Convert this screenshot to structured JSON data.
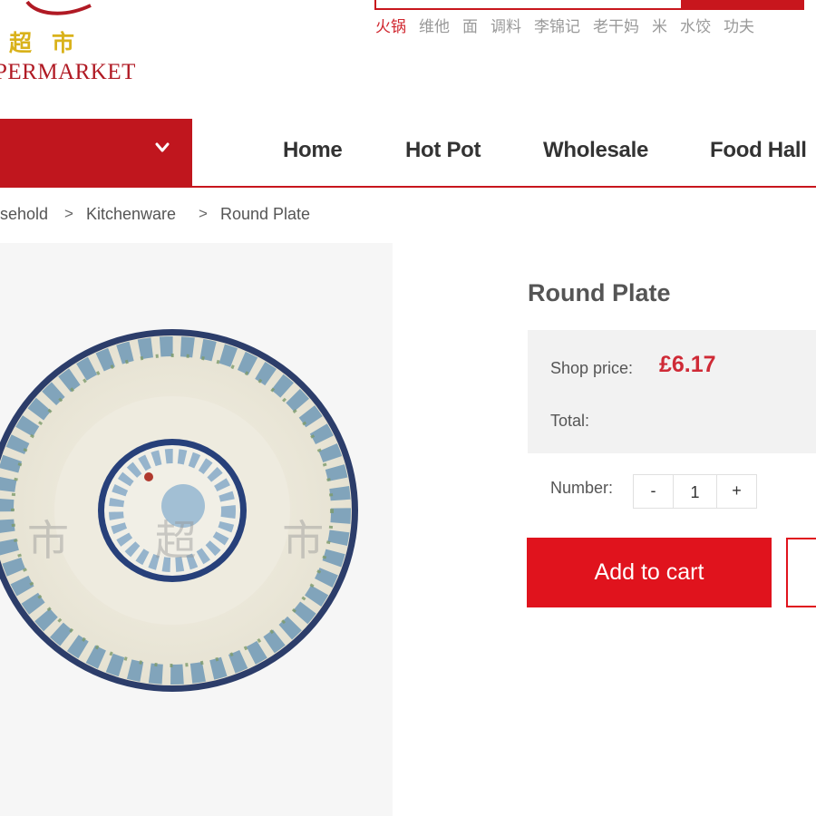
{
  "brand": {
    "name_cn": "超市",
    "name_en": "PERMARKET"
  },
  "search": {
    "hot_words": [
      "火锅",
      "维他",
      "面",
      "调料",
      "李锦记",
      "老干妈",
      "米",
      "水饺",
      "功夫"
    ]
  },
  "nav": {
    "items": [
      "Home",
      "Hot Pot",
      "Wholesale",
      "Food Hall"
    ]
  },
  "breadcrumb": {
    "items": [
      "sehold",
      "Kitchenware",
      "Round Plate"
    ],
    "separator": ">"
  },
  "product": {
    "title": "Round Plate",
    "price_label": "Shop price:",
    "price": "£6.17",
    "total_label": "Total:",
    "number_label": "Number:",
    "quantity": "1",
    "minus_label": "-",
    "plus_label": "+",
    "add_to_cart_label": "Add to cart"
  },
  "colors": {
    "brand_red": "#c8161d",
    "button_red": "#e0131d",
    "price_red": "#cf2a36",
    "logo_gold": "#d9b21b"
  }
}
